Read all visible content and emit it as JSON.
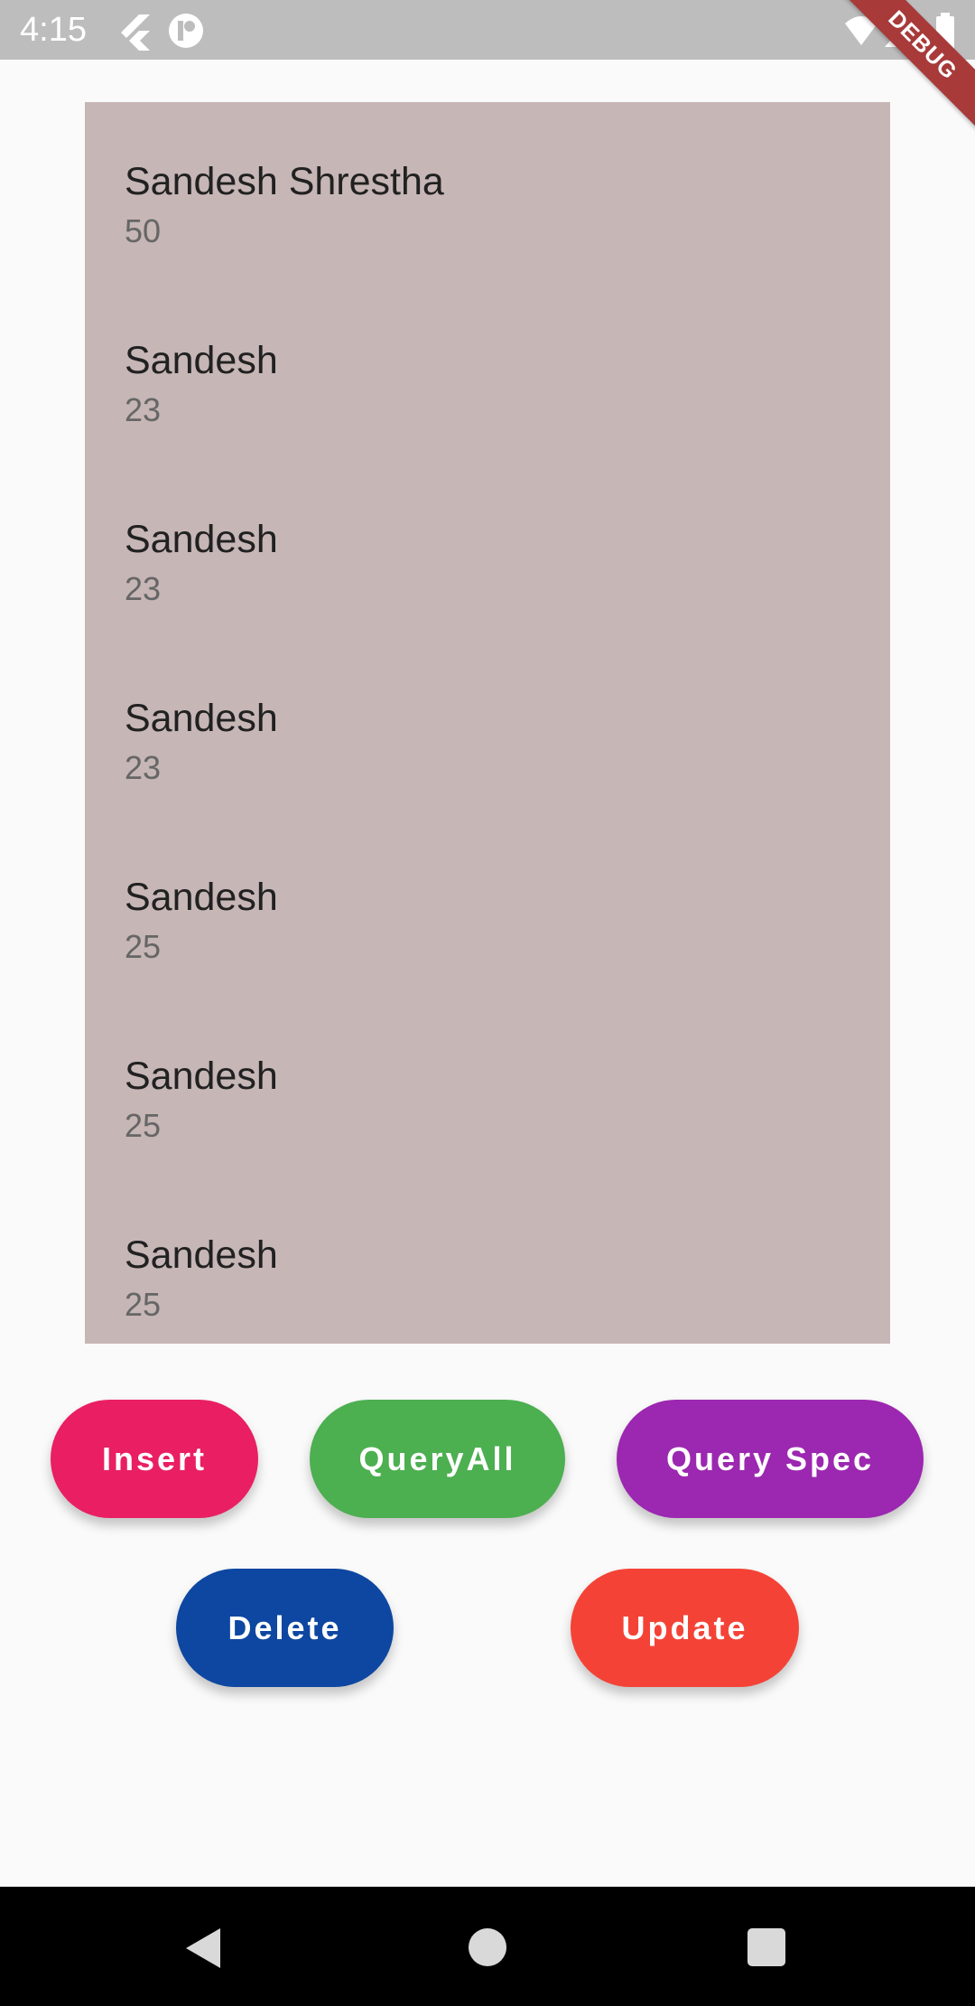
{
  "status_bar": {
    "time": "4:15",
    "icons": [
      "flutter-icon",
      "app-notification-icon",
      "wifi-icon",
      "signal-icon",
      "battery-icon"
    ]
  },
  "debug_banner": {
    "label": "DEBUG"
  },
  "list": {
    "background_color": "#c7b6b6",
    "items": [
      {
        "name": "Sandesh Shrestha",
        "age": "50"
      },
      {
        "name": "Sandesh",
        "age": "23"
      },
      {
        "name": "Sandesh",
        "age": "23"
      },
      {
        "name": "Sandesh",
        "age": "23"
      },
      {
        "name": "Sandesh",
        "age": "25"
      },
      {
        "name": "Sandesh",
        "age": "25"
      },
      {
        "name": "Sandesh",
        "age": "25"
      }
    ]
  },
  "buttons": {
    "insert": {
      "label": "Insert",
      "color": "#e91e63"
    },
    "query_all": {
      "label": "QueryAll",
      "color": "#4caf50"
    },
    "query_spec": {
      "label": "Query Spec",
      "color": "#9c27b0"
    },
    "delete": {
      "label": "Delete",
      "color": "#0d47a1"
    },
    "update": {
      "label": "Update",
      "color": "#f44336"
    }
  },
  "nav_bar": {
    "icons": [
      "back-icon",
      "home-icon",
      "recents-icon"
    ]
  }
}
